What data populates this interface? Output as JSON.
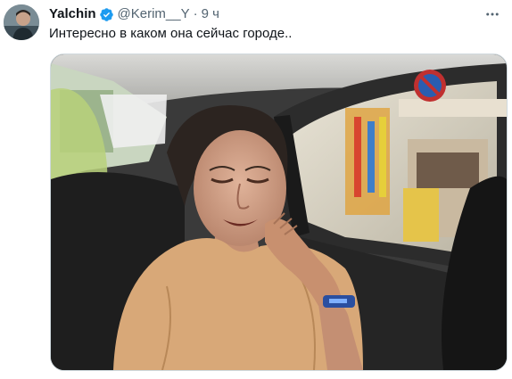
{
  "tweet": {
    "author": {
      "display_name": "Yalchin",
      "handle": "@Kerim__Y",
      "verified": true,
      "avatar_icon": "avatar-icon"
    },
    "separator": "·",
    "time": "9 ч",
    "text": "Интересно в каком она сейчас городе..",
    "more_icon": "more-options-icon",
    "media": {
      "type": "photo",
      "description_icon": "photo"
    }
  },
  "colors": {
    "text_primary": "#0f1419",
    "text_secondary": "#536471",
    "verified_blue": "#1d9bf0",
    "border": "#cfd9de"
  }
}
